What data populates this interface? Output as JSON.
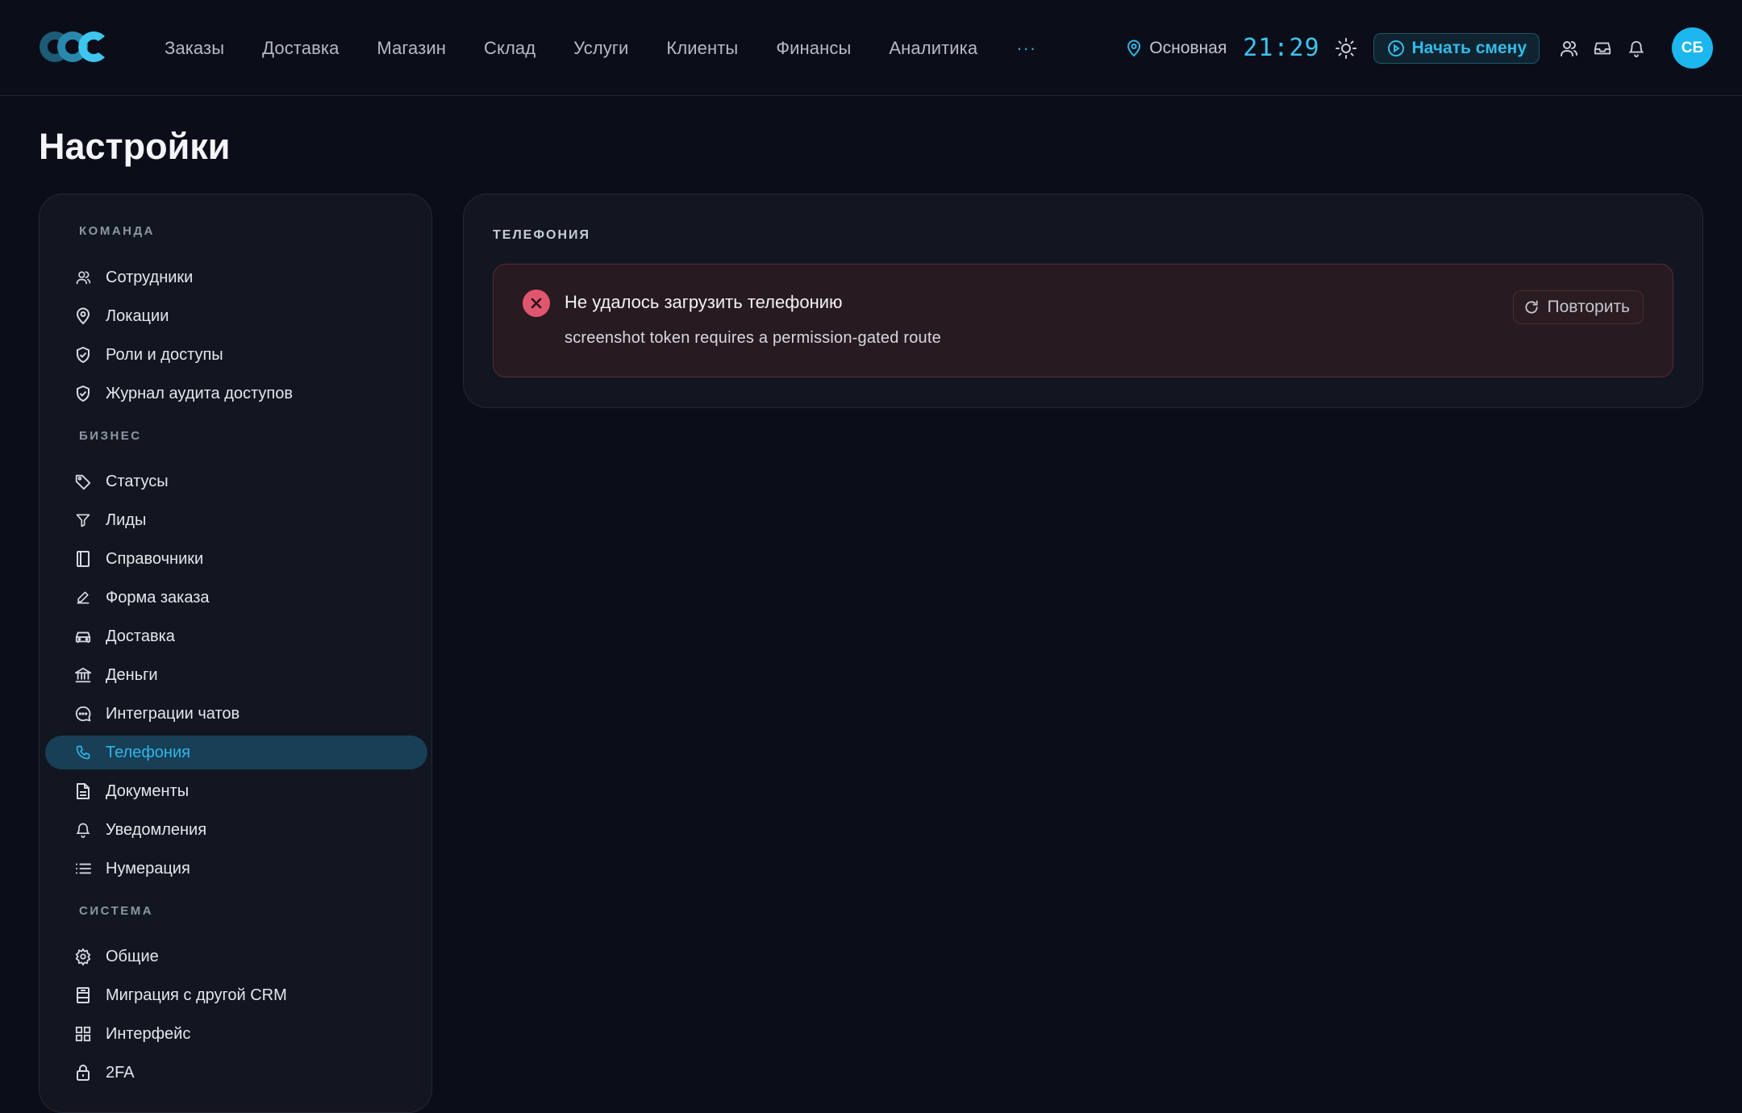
{
  "header": {
    "nav": [
      "Заказы",
      "Доставка",
      "Магазин",
      "Склад",
      "Услуги",
      "Клиенты",
      "Финансы",
      "Аналитика"
    ],
    "more_label": "···",
    "location": "Основная",
    "clock": "21:29",
    "start_shift": "Начать смену",
    "avatar_initials": "СБ"
  },
  "page": {
    "title": "Настройки"
  },
  "sidebar": {
    "sections": [
      {
        "label": "КОМАНДА",
        "items": [
          {
            "label": "Сотрудники",
            "icon": "users-icon"
          },
          {
            "label": "Локации",
            "icon": "map-pin-icon"
          },
          {
            "label": "Роли и доступы",
            "icon": "shield-check-icon"
          },
          {
            "label": "Журнал аудита доступов",
            "icon": "shield-check-icon"
          }
        ]
      },
      {
        "label": "БИЗНЕС",
        "items": [
          {
            "label": "Статусы",
            "icon": "tag-icon"
          },
          {
            "label": "Лиды",
            "icon": "funnel-icon"
          },
          {
            "label": "Справочники",
            "icon": "book-icon"
          },
          {
            "label": "Форма заказа",
            "icon": "pencil-icon"
          },
          {
            "label": "Доставка",
            "icon": "car-icon"
          },
          {
            "label": "Деньги",
            "icon": "bank-icon"
          },
          {
            "label": "Интеграции чатов",
            "icon": "chat-icon"
          },
          {
            "label": "Телефония",
            "icon": "phone-icon",
            "active": true
          },
          {
            "label": "Документы",
            "icon": "document-icon"
          },
          {
            "label": "Уведомления",
            "icon": "bell-icon"
          },
          {
            "label": "Нумерация",
            "icon": "list-icon"
          }
        ]
      },
      {
        "label": "СИСТЕМА",
        "items": [
          {
            "label": "Общие",
            "icon": "gear-icon"
          },
          {
            "label": "Миграция с другой CRM",
            "icon": "database-icon"
          },
          {
            "label": "Интерфейс",
            "icon": "grid-icon"
          },
          {
            "label": "2FA",
            "icon": "lock-icon"
          }
        ]
      }
    ]
  },
  "main": {
    "panel_label": "ТЕЛЕФОНИЯ",
    "error_title": "Не удалось загрузить телефонию",
    "error_message": "screenshot token requires a permission-gated route",
    "retry_label": "Повторить"
  },
  "colors": {
    "accent": "#22b3e6",
    "background": "#0b0e19",
    "panel": "#121620",
    "error": "#e0566e"
  }
}
